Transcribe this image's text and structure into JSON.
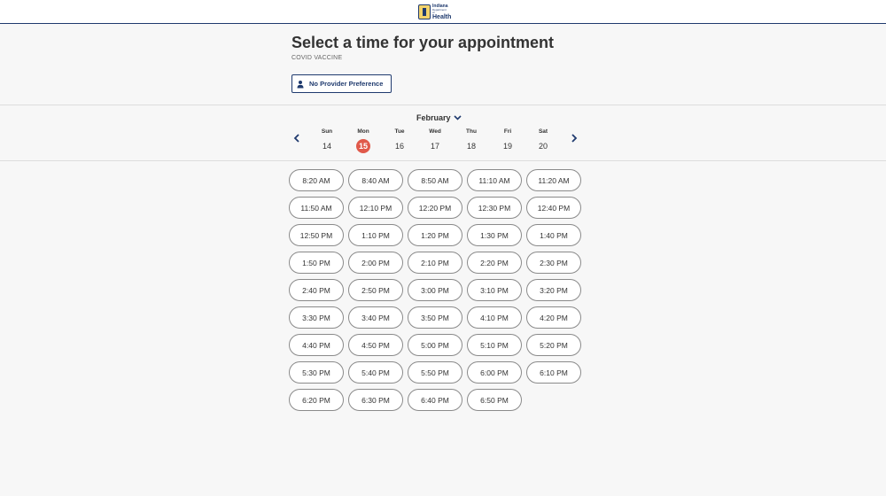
{
  "logo": {
    "line1": "Indiana",
    "line2": "Department",
    "line3": "of",
    "line4": "Health"
  },
  "page": {
    "title": "Select a time for your appointment",
    "subtitle": "COVID VACCINE"
  },
  "provider_button": {
    "label": "No Provider Preference",
    "icon": "person-icon"
  },
  "calendar": {
    "month": "February",
    "month_icon": "chevron-down-icon",
    "prev_icon": "chevron-left-icon",
    "next_icon": "chevron-right-icon",
    "selected_day": "15",
    "accent_color": "#e0594a",
    "days": [
      {
        "name": "Sun",
        "num": "14"
      },
      {
        "name": "Mon",
        "num": "15"
      },
      {
        "name": "Tue",
        "num": "16"
      },
      {
        "name": "Wed",
        "num": "17"
      },
      {
        "name": "Thu",
        "num": "18"
      },
      {
        "name": "Fri",
        "num": "19"
      },
      {
        "name": "Sat",
        "num": "20"
      }
    ]
  },
  "time_slots": [
    "8:20 AM",
    "8:40 AM",
    "8:50 AM",
    "11:10 AM",
    "11:20 AM",
    "11:50 AM",
    "12:10 PM",
    "12:20 PM",
    "12:30 PM",
    "12:40 PM",
    "12:50 PM",
    "1:10 PM",
    "1:20 PM",
    "1:30 PM",
    "1:40 PM",
    "1:50 PM",
    "2:00 PM",
    "2:10 PM",
    "2:20 PM",
    "2:30 PM",
    "2:40 PM",
    "2:50 PM",
    "3:00 PM",
    "3:10 PM",
    "3:20 PM",
    "3:30 PM",
    "3:40 PM",
    "3:50 PM",
    "4:10 PM",
    "4:20 PM",
    "4:40 PM",
    "4:50 PM",
    "5:00 PM",
    "5:10 PM",
    "5:20 PM",
    "5:30 PM",
    "5:40 PM",
    "5:50 PM",
    "6:00 PM",
    "6:10 PM",
    "6:20 PM",
    "6:30 PM",
    "6:40 PM",
    "6:50 PM"
  ],
  "colors": {
    "brand": "#1f3a6e",
    "selected_day": "#e0594a",
    "background": "#f7f7f7"
  }
}
